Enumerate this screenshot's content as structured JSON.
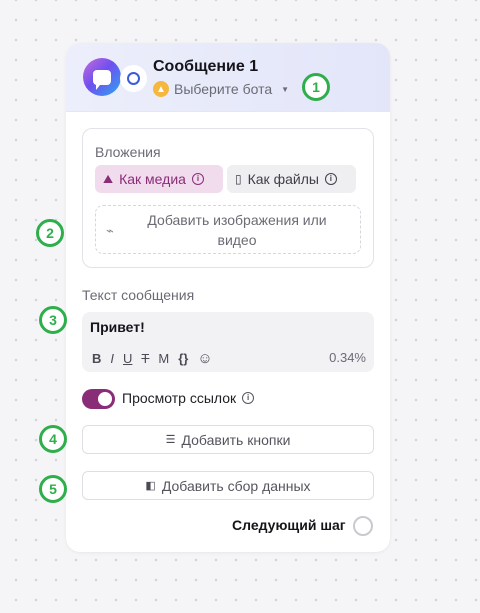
{
  "header": {
    "title": "Сообщение 1",
    "bot_select_placeholder": "Выберите бота"
  },
  "markers": [
    "1",
    "2",
    "3",
    "4",
    "5"
  ],
  "attachments": {
    "label": "Вложения",
    "as_media_label": "Как медиа",
    "as_files_label": "Как файлы",
    "dropzone_text": "Добавить изображения или видео"
  },
  "message": {
    "label": "Текст сообщения",
    "text": "Привет!",
    "toolbar": [
      "B",
      "I",
      "U",
      "T",
      "M",
      "{}",
      "☺"
    ],
    "usage_percent": "0.34%"
  },
  "link_preview": {
    "label": "Просмотр ссылок",
    "enabled": true
  },
  "buttons": {
    "add_buttons_label": "Добавить кнопки",
    "add_data_collection_label": "Добавить сбор данных"
  },
  "footer": {
    "next_step_label": "Следующий шаг"
  },
  "colors": {
    "accent": "#8a2d77",
    "marker": "#2fae4c",
    "warning": "#f5b73d"
  }
}
